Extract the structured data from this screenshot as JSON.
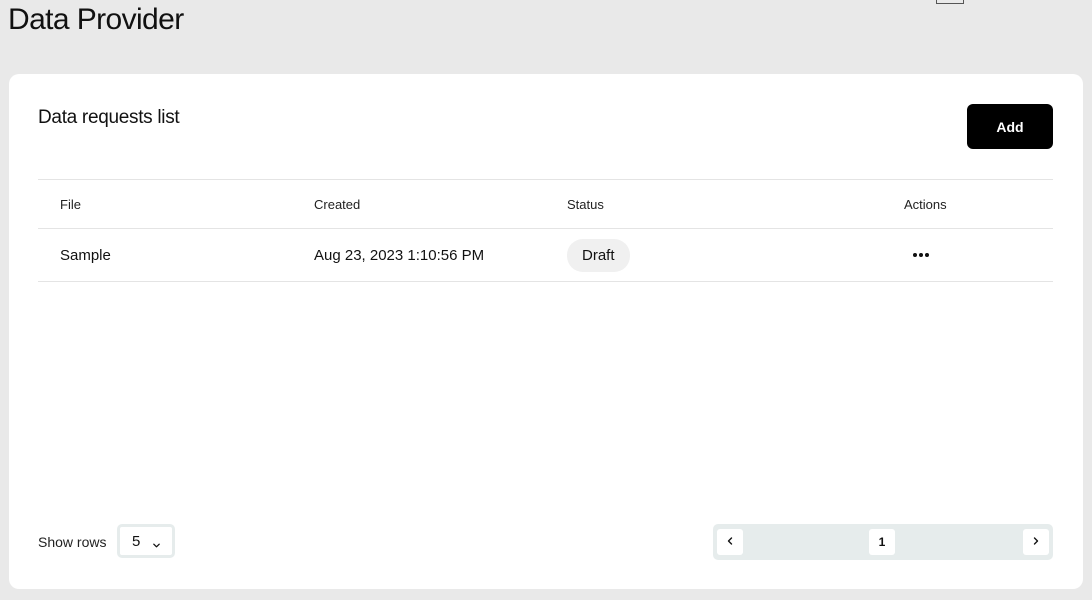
{
  "page": {
    "title": "Data Provider"
  },
  "card": {
    "title": "Data requests list",
    "add_label": "Add"
  },
  "table": {
    "columns": {
      "file": "File",
      "created": "Created",
      "status": "Status",
      "actions": "Actions"
    },
    "rows": [
      {
        "file": "Sample",
        "created": "Aug 23, 2023 1:10:56 PM",
        "status": "Draft",
        "actions_icon": "more-horizontal-icon"
      }
    ]
  },
  "footer": {
    "show_rows_label": "Show rows",
    "rows_per_page": "5",
    "current_page": "1"
  },
  "icons": {
    "rows_select": "chevron-down-icon",
    "prev": "chevron-left-icon",
    "next": "chevron-right-icon"
  },
  "colors": {
    "background": "#e9e9e9",
    "card": "#ffffff",
    "primary_button": "#000000",
    "badge": "#f0f0f0",
    "pager": "#e6ecec"
  }
}
